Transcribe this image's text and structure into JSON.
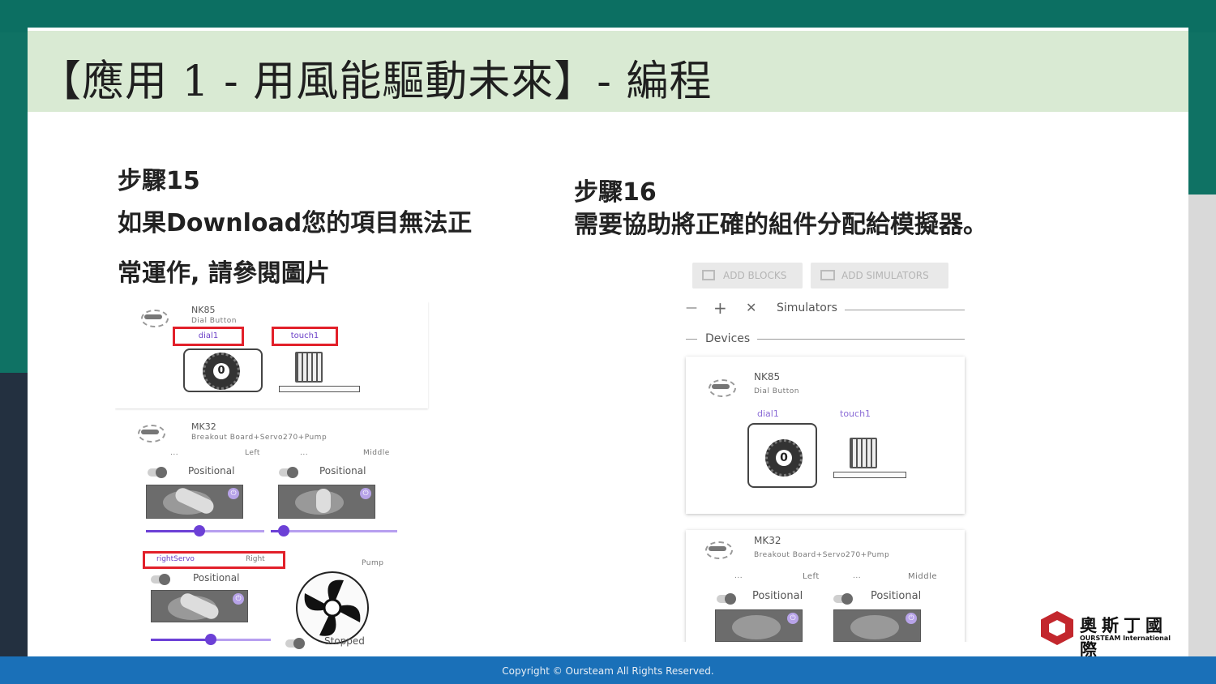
{
  "slide": {
    "title": "【應用 1 - 用風能驅動未來】- 編程",
    "footer": "Copyright © Oursteam All Rights Reserved."
  },
  "step15": {
    "heading": "步驟15",
    "line1": "如果Download您的項目無法正",
    "line2": "常運作, 請參閱圖片"
  },
  "step16": {
    "heading": "步驟16",
    "line1": "需要協助將正確的組件分配給模擬器。"
  },
  "left_shot": {
    "nk85_name": "NK85",
    "nk85_sub": "Dial Button",
    "dial_label": "dial1",
    "touch_label": "touch1",
    "dial_value": "0",
    "mk32_name": "MK32",
    "mk32_sub": "Breakout Board+Servo270+Pump",
    "dots1": "...",
    "left_label": "Left",
    "dots2": "...",
    "middle_label": "Middle",
    "positional1": "Positional",
    "positional2": "Positional",
    "right_servo_label": "rightServo",
    "right_label": "Right",
    "pump_label": "Pump",
    "positional3": "Positional",
    "stopped": "Stopped",
    "slider_left_value": 0.45,
    "slider_middle_value": 0.1,
    "slider_right_value": 0.5
  },
  "right_shot": {
    "add_blocks": "ADD BLOCKS",
    "add_simulators": "ADD SIMULATORS",
    "minus": "—",
    "plus": "+",
    "close": "✕",
    "simulators": "Simulators",
    "devices": "Devices",
    "nk85_name": "NK85",
    "nk85_sub": "Dial Button",
    "dial_label": "dial1",
    "touch_label": "touch1",
    "dial_value": "0",
    "mk32_name": "MK32",
    "mk32_sub": "Breakout Board+Servo270+Pump",
    "dots1": "...",
    "left_label": "Left",
    "dots2": "...",
    "middle_label": "Middle",
    "positional1": "Positional",
    "positional2": "Positional"
  },
  "logo": {
    "cn": "奧斯丁國際",
    "en": "OURSTEAM International"
  },
  "colors": {
    "teal": "#0f7264",
    "title_band": "#d9ead3",
    "footer": "#1a70b8",
    "highlight_red": "#e2202a",
    "purple": "#6c40d6"
  }
}
